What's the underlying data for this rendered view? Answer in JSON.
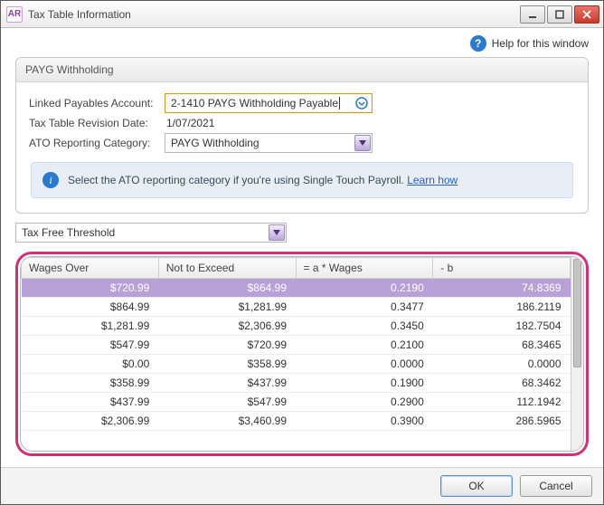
{
  "window": {
    "app_icon_text": "AR",
    "title": "Tax Table Information"
  },
  "help": {
    "label": "Help for this window"
  },
  "group": {
    "title": "PAYG Withholding",
    "linked_label": "Linked Payables Account:",
    "linked_value": "2-1410 PAYG Withholding Payable",
    "revision_label": "Tax Table Revision Date:",
    "revision_value": "1/07/2021",
    "ato_label": "ATO Reporting Category:",
    "ato_value": "PAYG Withholding",
    "banner_text": "Select the ATO reporting category if you're using Single Touch Payroll.",
    "banner_link": "Learn how"
  },
  "threshold_select": "Tax Free Threshold",
  "columns": [
    "Wages Over",
    "Not to Exceed",
    "= a * Wages",
    "- b"
  ],
  "rows": [
    {
      "wages_over": "$720.99",
      "not_exceed": "$864.99",
      "a": "0.2190",
      "b": "74.8369",
      "selected": true
    },
    {
      "wages_over": "$864.99",
      "not_exceed": "$1,281.99",
      "a": "0.3477",
      "b": "186.2119"
    },
    {
      "wages_over": "$1,281.99",
      "not_exceed": "$2,306.99",
      "a": "0.3450",
      "b": "182.7504"
    },
    {
      "wages_over": "$547.99",
      "not_exceed": "$720.99",
      "a": "0.2100",
      "b": "68.3465"
    },
    {
      "wages_over": "$0.00",
      "not_exceed": "$358.99",
      "a": "0.0000",
      "b": "0.0000"
    },
    {
      "wages_over": "$358.99",
      "not_exceed": "$437.99",
      "a": "0.1900",
      "b": "68.3462"
    },
    {
      "wages_over": "$437.99",
      "not_exceed": "$547.99",
      "a": "0.2900",
      "b": "112.1942"
    },
    {
      "wages_over": "$2,306.99",
      "not_exceed": "$3,460.99",
      "a": "0.3900",
      "b": "286.5965"
    }
  ],
  "buttons": {
    "ok": "OK",
    "cancel": "Cancel"
  }
}
